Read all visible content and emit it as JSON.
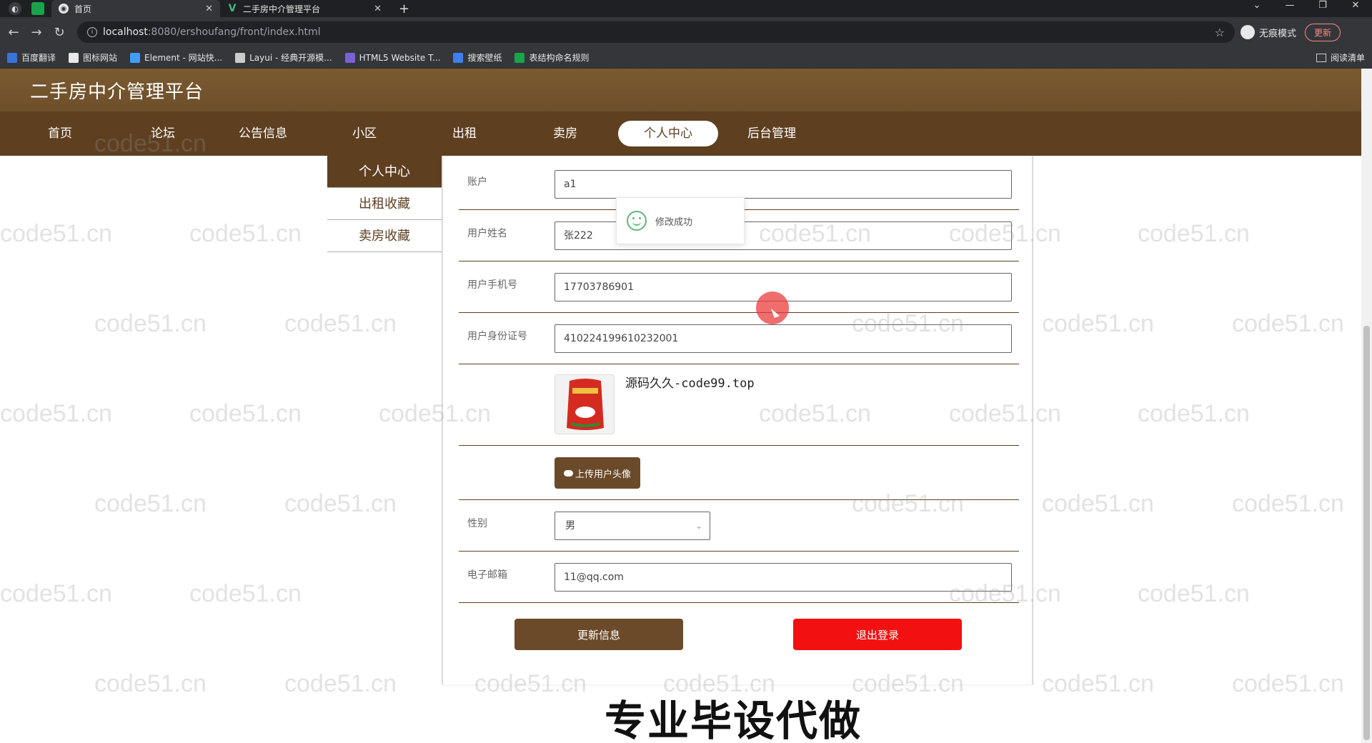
{
  "browser": {
    "tabs": [
      {
        "label": "首页",
        "active": true
      },
      {
        "label": "二手房中介管理平台",
        "active": false
      }
    ],
    "new_tab": "+",
    "url_host": "localhost",
    "url_path": ":8080/ershoufang/front/index.html",
    "incognito_label": "无痕模式",
    "update_label": "更新",
    "bookmarks": [
      {
        "label": "百度翻译",
        "color": "#3a73d9"
      },
      {
        "label": "图标网站",
        "color": "#e8e8e8"
      },
      {
        "label": "Element - 网站快...",
        "color": "#409eff"
      },
      {
        "label": "Layui - 经典开源模...",
        "color": "#cccccc"
      },
      {
        "label": "HTML5 Website T...",
        "color": "#7a61d6"
      },
      {
        "label": "搜索壁纸",
        "color": "#3d7ff0"
      },
      {
        "label": "表结构命名规则",
        "color": "#1aa34a"
      }
    ],
    "reading_list": "阅读清单"
  },
  "site": {
    "title": "二手房中介管理平台",
    "nav": [
      "首页",
      "论坛",
      "公告信息",
      "小区",
      "出租",
      "卖房",
      "个人中心",
      "后台管理"
    ],
    "nav_active_index": 6,
    "side_menu": [
      {
        "label": "个人中心",
        "active": true
      },
      {
        "label": "出租收藏",
        "active": false
      },
      {
        "label": "卖房收藏",
        "active": false
      }
    ]
  },
  "form": {
    "account": {
      "label": "账户",
      "value": "a1"
    },
    "username": {
      "label": "用户姓名",
      "value": "张222"
    },
    "phone": {
      "label": "用户手机号",
      "value": "17703786901"
    },
    "idcard": {
      "label": "用户身份证号",
      "value": "410224199610232001"
    },
    "upload_label": "上传用户头像",
    "gender": {
      "label": "性别",
      "value": "男"
    },
    "email": {
      "label": "电子邮箱",
      "value": "11@qq.com"
    },
    "update_button": "更新信息",
    "logout_button": "退出登录"
  },
  "toast": {
    "message": "修改成功"
  },
  "promo_text": "源码久久-code99.top",
  "watermark_text": "code51.cn",
  "caption": "专业毕设代做",
  "colors": {
    "header_brown": "#6d4f2b",
    "nav_brown": "#5e3f20",
    "button_brown": "#6b4a2a",
    "logout_red": "#f21010"
  }
}
